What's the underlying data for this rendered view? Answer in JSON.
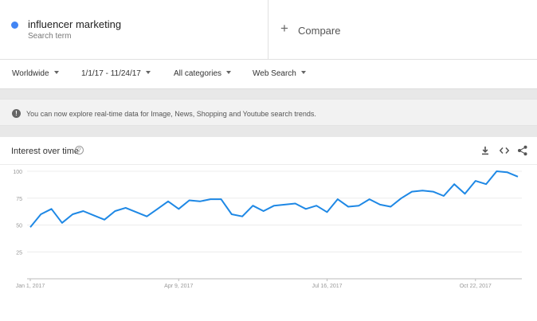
{
  "search_term": {
    "name": "influencer marketing",
    "subtitle": "Search term",
    "color": "#4285f4"
  },
  "compare": {
    "label": "Compare",
    "icon": "plus-icon"
  },
  "filters": {
    "region": "Worldwide",
    "date_range": "1/1/17 - 11/24/17",
    "category": "All categories",
    "search_type": "Web Search"
  },
  "notice": {
    "icon": "exclamation-icon",
    "text": "You can now explore real-time data for Image, News, Shopping and Youtube search trends."
  },
  "card": {
    "title": "Interest over time",
    "help_icon": "question-icon",
    "tools": [
      "download-icon",
      "embed-code-icon",
      "share-icon"
    ]
  },
  "chart_data": {
    "type": "line",
    "title": "",
    "xlabel": "",
    "ylabel": "",
    "ylim": [
      0,
      100
    ],
    "yticks": [
      25,
      50,
      75,
      100
    ],
    "grid": true,
    "line_color": "#1e88e5",
    "x_tick_labels": [
      {
        "label": "Jan 1, 2017",
        "index": 0
      },
      {
        "label": "Apr 9, 2017",
        "index": 14
      },
      {
        "label": "Jul 16, 2017",
        "index": 28
      },
      {
        "label": "Oct 22, 2017",
        "index": 42
      }
    ],
    "series": [
      {
        "values": [
          48,
          60,
          65,
          52,
          60,
          63,
          59,
          55,
          63,
          66,
          62,
          58,
          65,
          72,
          65,
          73,
          72,
          74,
          74,
          60,
          58,
          68,
          63,
          68,
          69,
          70,
          65,
          68,
          62,
          74,
          67,
          68,
          74,
          69,
          67,
          75,
          81,
          82,
          81,
          77,
          88,
          79,
          91,
          88,
          100,
          99,
          95
        ]
      }
    ]
  }
}
